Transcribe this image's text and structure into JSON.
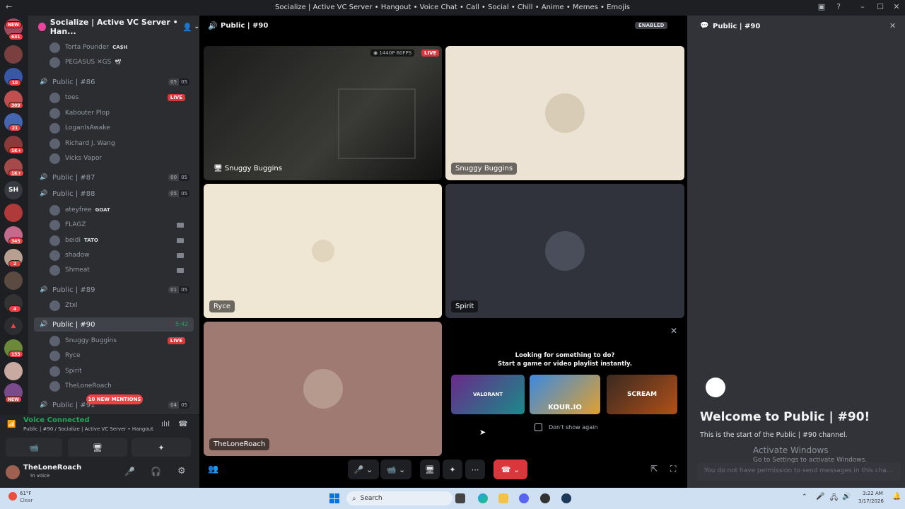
{
  "window": {
    "title": "Socialize | Active VC Server • Hangout • Voice Chat • Call • Social • Chill • Anime • Memes • Emojis"
  },
  "rail": {
    "badges": [
      "NEW",
      "631",
      "10",
      "309",
      "21",
      "1K+",
      "1K+",
      "SH",
      "345",
      "2",
      "4",
      "155",
      "NEW"
    ]
  },
  "server": {
    "name": "Socialize | Active VC Server • Han..."
  },
  "channels": [
    {
      "label": "Public | #86",
      "count": [
        "05",
        "05"
      ]
    },
    {
      "label": "Public | #87",
      "count": [
        "00",
        "05"
      ]
    },
    {
      "label": "Public | #88",
      "count": [
        "05",
        "05"
      ]
    },
    {
      "label": "Public | #89",
      "count": [
        "01",
        "05"
      ]
    },
    {
      "label": "Public | #90",
      "timer": "5:42"
    },
    {
      "label": "Public | #91",
      "count": [
        "04",
        "05"
      ]
    }
  ],
  "users": {
    "top": [
      {
        "name": "Torta Pounder",
        "tag": "CA$H"
      },
      {
        "name": "PEGASUS ✕GS",
        "tag": "🕊"
      }
    ],
    "c86": [
      "toes",
      "Kabouter Plop",
      "LoganIsAwake",
      "Richard J. Wang",
      "Vicks Vapor"
    ],
    "c88": [
      {
        "name": "ateyfree",
        "tag": "GOAT"
      },
      {
        "name": "FLAGZ"
      },
      {
        "name": "beidi",
        "tag": "TATO"
      },
      {
        "name": "shadow"
      },
      {
        "name": "Shmeat"
      }
    ],
    "c89": [
      "Ztxl"
    ],
    "c90": [
      "Snuggy Buggins",
      "Ryce",
      "Spirit",
      "TheLoneRoach"
    ]
  },
  "live_label": "LIVE",
  "mentions": "10 NEW MENTIONS",
  "voice": {
    "status": "Voice Connected",
    "location": "Public | #90 / Socialize | Active VC Server • Hangout..."
  },
  "me": {
    "name": "TheLoneRoach",
    "status": "In voice"
  },
  "main": {
    "channel": "Public | #90",
    "enabled": "ENABLED",
    "stream_quality": "1440P 60FPS",
    "live": "LIVE",
    "tiles": [
      "Snuggy Buggins",
      "Snuggy Buggins",
      "Ryce",
      "Spirit",
      "TheLoneRoach"
    ],
    "activity": {
      "line1": "Looking for something to do?",
      "line2": "Start a game or video playlist instantly.",
      "games": [
        "VALORANT",
        "KOUR.IO",
        "SCREAM"
      ],
      "dont_show": "Don't show again"
    }
  },
  "right": {
    "channel": "Public | #90",
    "welcome": "Welcome to Public | #90!",
    "start": "This is the start of the Public | #90 channel.",
    "activate": "Activate Windows",
    "activate_sub": "Go to Settings to activate Windows.",
    "no_perm": "You do not have permission to send messages in this cha..."
  },
  "taskbar": {
    "weather_temp": "61°F",
    "weather_desc": "Clear",
    "search": "Search",
    "time": "3:22 AM",
    "date": "3/17/2026"
  },
  "colors": {
    "accent": "#5865f2",
    "green": "#23a55a",
    "red": "#da373c",
    "bg": "#313338"
  }
}
